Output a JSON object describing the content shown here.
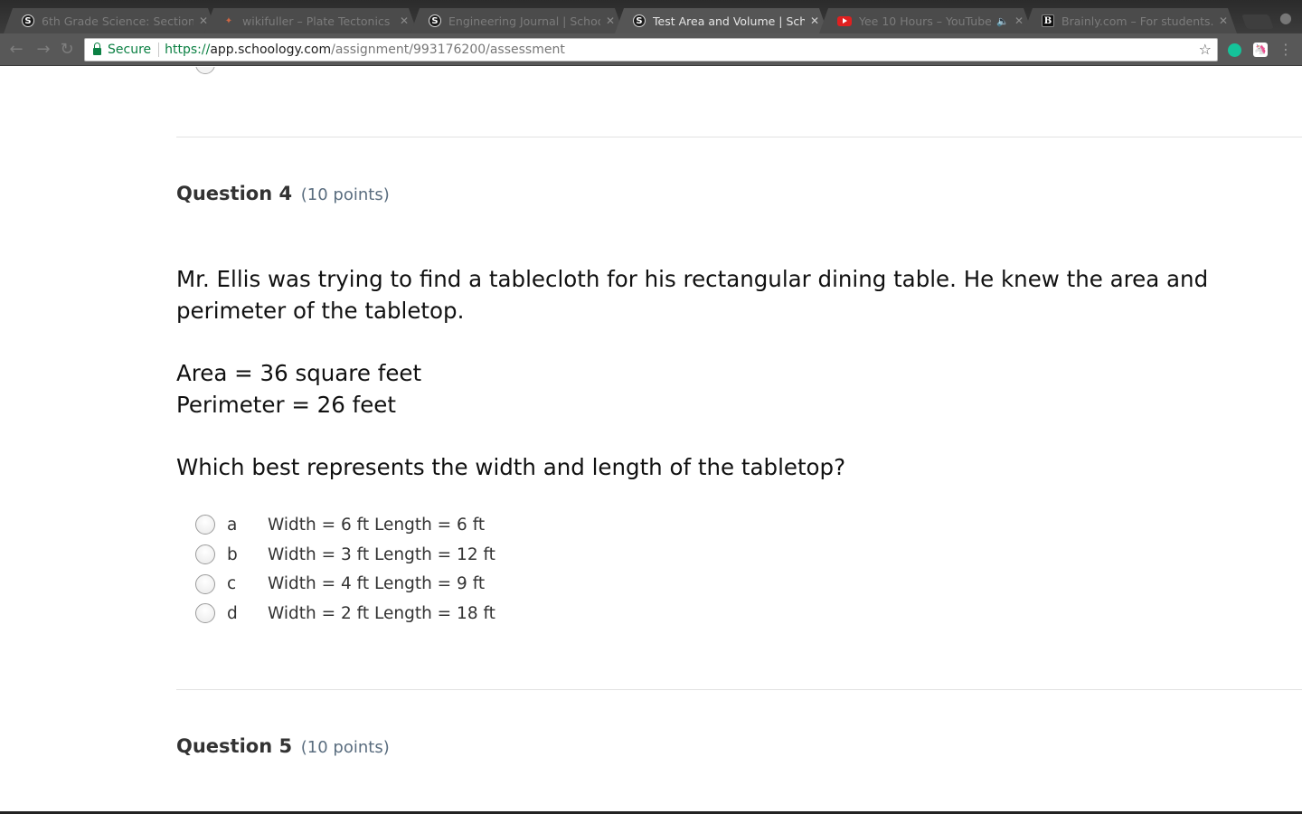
{
  "browser": {
    "tabs": [
      {
        "title": "6th Grade Science: Section",
        "icon": "schoology-icon",
        "active": false
      },
      {
        "title": "wikifuller – Plate Tectonics",
        "icon": "wiki-icon",
        "active": false
      },
      {
        "title": "Engineering Journal | Schoolo",
        "icon": "schoology-icon",
        "active": false
      },
      {
        "title": "Test Area and Volume | Schoo",
        "icon": "schoology-icon",
        "active": true
      },
      {
        "title": "Yee 10 Hours – YouTube",
        "icon": "youtube-icon",
        "active": false
      },
      {
        "title": "Brainly.com – For students.",
        "icon": "brainly-icon",
        "active": false
      }
    ],
    "address": {
      "secure_label": "Secure",
      "scheme": "https://",
      "host": "app.schoology.com",
      "path": "/assignment/993176200/assessment"
    }
  },
  "questions": [
    {
      "title": "Question 4",
      "points": "(10 points)"
    },
    {
      "title": "Question 5",
      "points": "(10 points)"
    }
  ],
  "question4": {
    "intro": "Mr. Ellis was trying to find a tablecloth for his rectangular dining table. He knew the area and perimeter of the tabletop.",
    "area": "Area = 36 square feet",
    "perimeter": "Perimeter = 26 feet",
    "prompt": "Which best represents the width and length of the tabletop?",
    "options": [
      {
        "letter": "a",
        "text": "Width = 6 ft Length = 6 ft"
      },
      {
        "letter": "b",
        "text": "Width = 3 ft Length = 12 ft"
      },
      {
        "letter": "c",
        "text": "Width = 4 ft Length = 9 ft"
      },
      {
        "letter": "d",
        "text": "Width = 2 ft Length = 18 ft"
      }
    ]
  }
}
